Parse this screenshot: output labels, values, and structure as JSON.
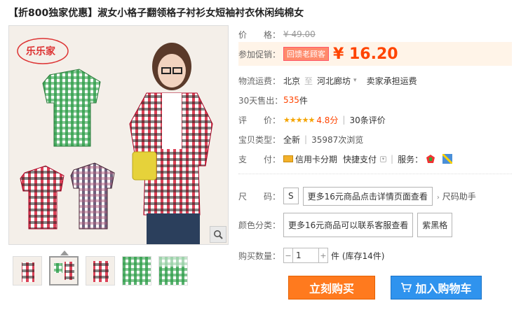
{
  "title": "【折800独家优惠】淑女小格子翻领格子衬衫女短袖衬衣休闲纯棉女",
  "brand_logo": "乐乐家",
  "price": {
    "label": "价　　格：",
    "original": "¥ 49.00"
  },
  "promo": {
    "label": "参加促销：",
    "tag": "回馈老顾客",
    "price": "¥ 16.20"
  },
  "shipping": {
    "label": "物流运费：",
    "from": "北京",
    "sep": "至",
    "to": "河北廊坊",
    "fee": "卖家承担运费"
  },
  "sales": {
    "label": "30天售出：",
    "count": "535",
    "unit": "件"
  },
  "rating": {
    "label": "评　　价：",
    "stars": "★★★★★",
    "score": "4.8分",
    "reviews": "30条评价"
  },
  "type": {
    "label": "宝贝类型：",
    "condition": "全新",
    "views": "35987次浏览"
  },
  "payment": {
    "label": "支　　付：",
    "method": "信用卡分期",
    "quick": "快捷支付",
    "service_label": "服务："
  },
  "size": {
    "label": "尺　　码：",
    "options": [
      "S",
      "更多16元商品点击详情页面查看"
    ],
    "helper": "尺码助手"
  },
  "color": {
    "label": "颜色分类：",
    "options": [
      "更多16元商品可以联系客服查看",
      "紫黑格"
    ]
  },
  "quantity": {
    "label": "购买数量：",
    "value": "1",
    "stock": "件 (库存14件)"
  },
  "actions": {
    "buy_now": "立刻购买",
    "add_cart": "加入购物车"
  },
  "colors": {
    "accent": "#ff4400",
    "buy": "#ff7a1e",
    "cart": "#2f93ee"
  }
}
